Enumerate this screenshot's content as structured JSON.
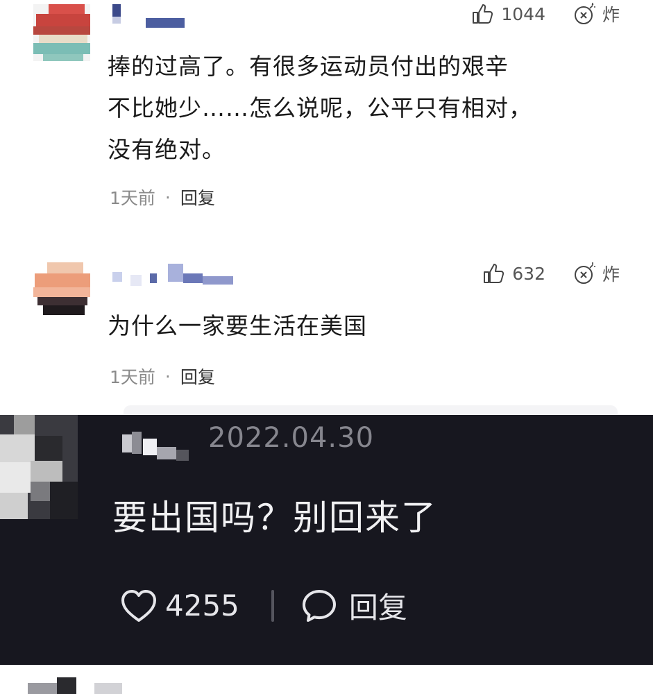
{
  "comments": [
    {
      "likes": "1044",
      "bomb_label": "炸",
      "text_lines": [
        "捧的过高了。有很多运动员付出的艰辛",
        "不比她少……怎么说呢，公平只有相对，",
        "没有绝对。"
      ],
      "time": "1天前",
      "separator": "·",
      "reply_label": "回复"
    },
    {
      "likes": "632",
      "bomb_label": "炸",
      "text_lines": [
        "为什么一家要生活在美国"
      ],
      "time": "1天前",
      "separator": "·",
      "reply_label": "回复"
    }
  ],
  "dark_card": {
    "date": "2022.04.30",
    "text": "要出国吗？别回来了",
    "likes": "4255",
    "reply_label": "回复"
  },
  "icons": {
    "like": "thumbs-up-icon",
    "bomb": "bomb-icon",
    "heart": "heart-icon",
    "chat": "chat-bubble-icon"
  },
  "colors": {
    "background": "#ffffff",
    "dark_background": "#17171f",
    "meta_text": "#8a8a8a",
    "dark_text": "#f1f1f3"
  }
}
